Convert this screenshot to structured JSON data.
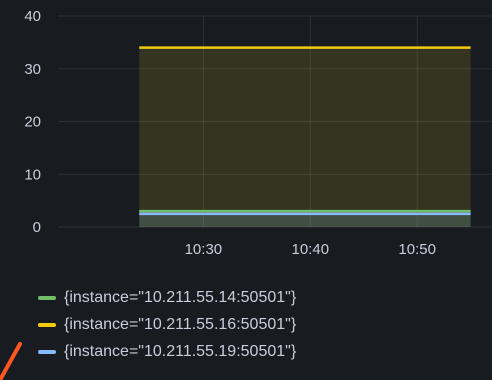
{
  "chart_data": {
    "type": "area",
    "title": "",
    "xlabel": "",
    "ylabel": "",
    "ylim": [
      0,
      40
    ],
    "yticks": [
      "0",
      "10",
      "20",
      "30",
      "40"
    ],
    "xticks": [
      "10:30",
      "10:40",
      "10:50"
    ],
    "grid": true,
    "legend_position": "bottom-left",
    "x": [
      "10:24",
      "10:55"
    ],
    "series": [
      {
        "name": "{instance=\"10.211.55.14:50501\"}",
        "color": "#73bf69",
        "values": [
          3,
          3
        ]
      },
      {
        "name": "{instance=\"10.211.55.16:50501\"}",
        "color": "#fade2a",
        "values": [
          34,
          34
        ]
      },
      {
        "name": "{instance=\"10.211.55.19:50501\"}",
        "color": "#5794f2",
        "values": [
          2.5,
          2.5
        ]
      }
    ]
  },
  "legend_colors": [
    "#73bf69",
    "#f2cc0c",
    "#8ab8ff"
  ],
  "annotation": {
    "color": "#ff5722",
    "icon": "arrow-annotation-icon"
  }
}
